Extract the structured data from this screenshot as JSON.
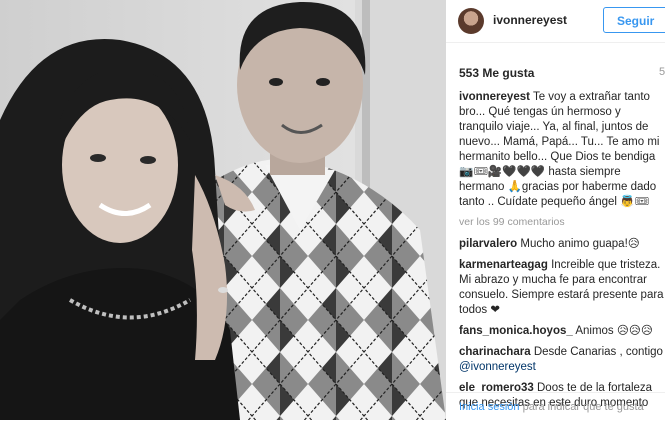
{
  "header": {
    "username": "ivonnereyest",
    "follow_label": "Seguir"
  },
  "likes": "553 Me gusta",
  "age": "5",
  "caption": {
    "user": "ivonnereyest",
    "text": "Te voy a extrañar tanto bro... Qué tengas ún hermoso y tranquilo viaje... Ya, al final, juntos de nuevo... Mamá, Papá... Tu... Te amo mi hermanito bello... Que Dios te bendiga 📷🎟🎥🖤🖤🖤 hasta siempre hermano 🙏gracias por haberme dado tanto .. Cuídate pequeño ángel 👼🎟"
  },
  "view_all_comments": "ver los 99 comentarios",
  "comments": [
    {
      "user": "pilarvalero",
      "text": "Mucho animo guapa!😥"
    },
    {
      "user": "karmenarteagag",
      "text": "Increible que tristeza. Mi abrazo y mucha fe para encontrar consuelo. Siempre estará presente para todos ❤"
    },
    {
      "user": "fans_monica.hoyos_",
      "text": "Animos 😥😥😥"
    },
    {
      "user": "charinachara",
      "text": "Desde Canarias , contigo",
      "mention": "@ivonnereyest"
    },
    {
      "user": "ele_romero33",
      "text": "Doos te de la fortaleza que necesitas en este duro momento"
    }
  ],
  "footer": {
    "login_label": "Inicia sesión",
    "rest": " para indicar que te gusta"
  },
  "colors": {
    "accent": "#3897f0",
    "text": "#262626",
    "muted": "#999999",
    "mention": "#003569"
  }
}
